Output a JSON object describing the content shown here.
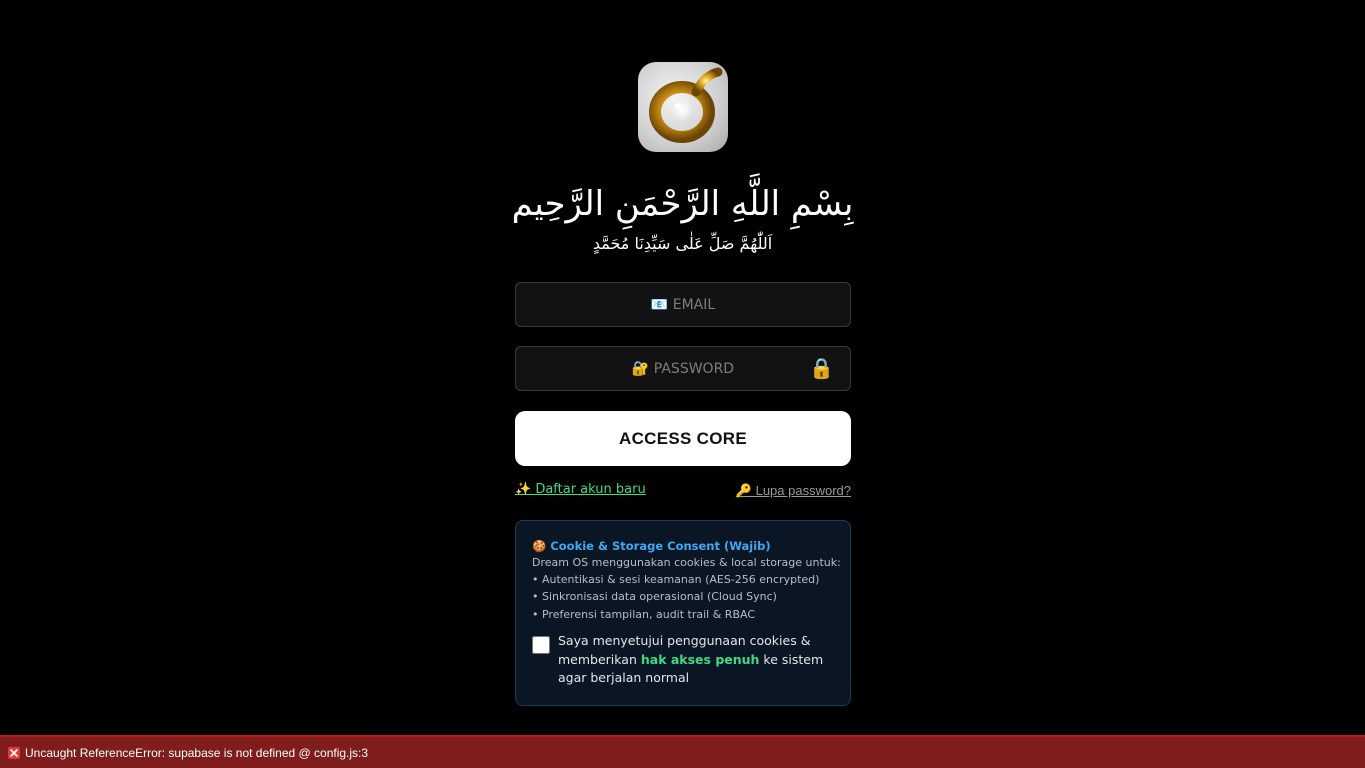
{
  "app": {
    "logo_icon": "golden-d-ring-logo-icon",
    "accent_color": "#3ddc84"
  },
  "header": {
    "bismillah": "بِسْمِ اللَّهِ الرَّحْمَنِ الرَّحِيم",
    "salawat": "اَللّٰهُمَّ صَلِّ عَلٰى سَيِّدِنَا مُحَمَّدٍ"
  },
  "login": {
    "email_placeholder": "📧 EMAIL",
    "email_value": "",
    "password_placeholder": "🔐 PASSWORD",
    "password_value": "",
    "password_toggle_icon": "🔒",
    "submit_label": "ACCESS CORE",
    "register_link": "✨ Daftar akun baru",
    "forgot_link": "🔑 Lupa password?"
  },
  "consent": {
    "title": "🍪 Cookie & Storage Consent (Wajib)",
    "lines": [
      "Dream OS menggunakan cookies & local storage untuk:",
      "• Autentikasi & sesi keamanan (AES-256 encrypted)",
      "• Sinkronisasi data operasional (Cloud Sync)",
      "• Preferensi tampilan, audit trail & RBAC"
    ],
    "agree_prefix": "Saya menyetujui penggunaan cookies & memberikan ",
    "agree_highlight": "hak akses penuh",
    "agree_suffix": " ke sistem agar berjalan normal",
    "checked": false,
    "title_color": "#3ea8f0"
  },
  "error": {
    "icon": "close-icon",
    "message": "Uncaught ReferenceError: supabase is not defined @ config.js:3",
    "bar_color": "#7f1d1d"
  }
}
